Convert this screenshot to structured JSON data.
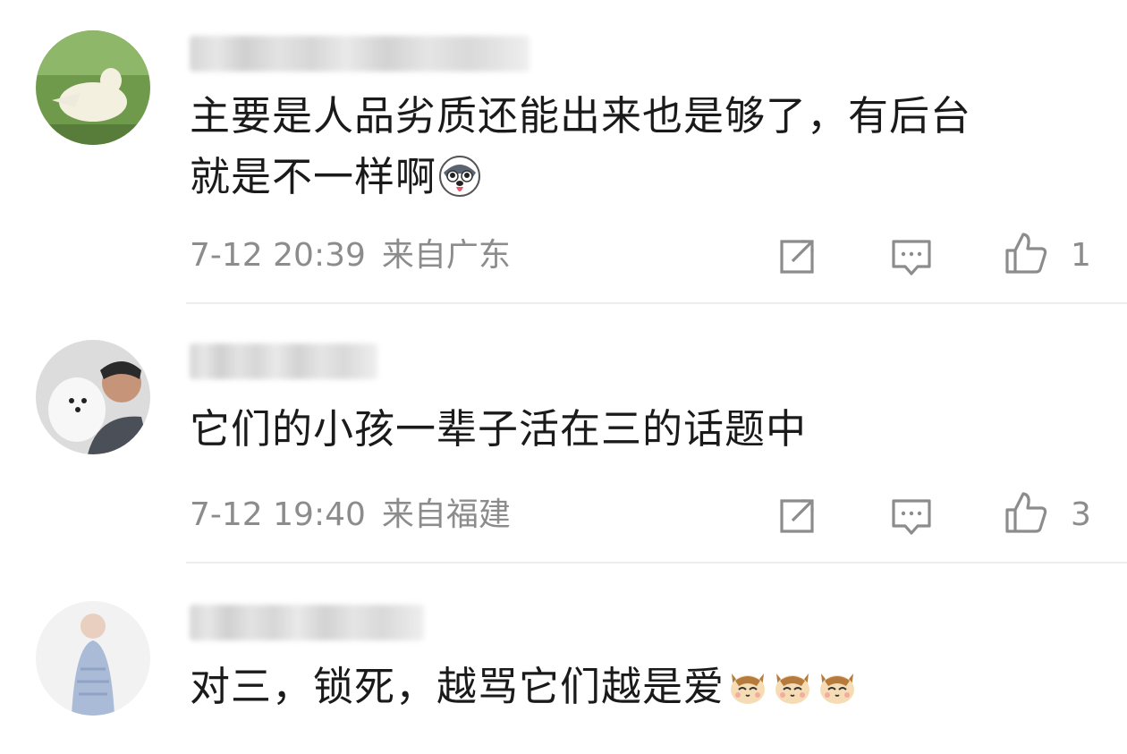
{
  "comments": [
    {
      "text_line1": "主要是人品劣质还能出来也是够了，有后台",
      "text_line2": "就是不一样啊",
      "emoji": "husky-emoji",
      "date": "7-12 20:39",
      "location": "来自广东",
      "like_count": "1"
    },
    {
      "text_line1": "它们的小孩一辈子活在三的话题中",
      "date": "7-12 19:40",
      "location": "来自福建",
      "like_count": "3"
    },
    {
      "text_line1": "对三，锁死，越骂它们越是爱",
      "emoji": "cat-emoji"
    }
  ],
  "icons": {
    "share": "share-icon",
    "comment": "comment-icon",
    "like": "thumbs-up-icon"
  },
  "colors": {
    "text": "#1a1a1a",
    "meta": "#8c8c8c",
    "divider": "#ececec"
  }
}
